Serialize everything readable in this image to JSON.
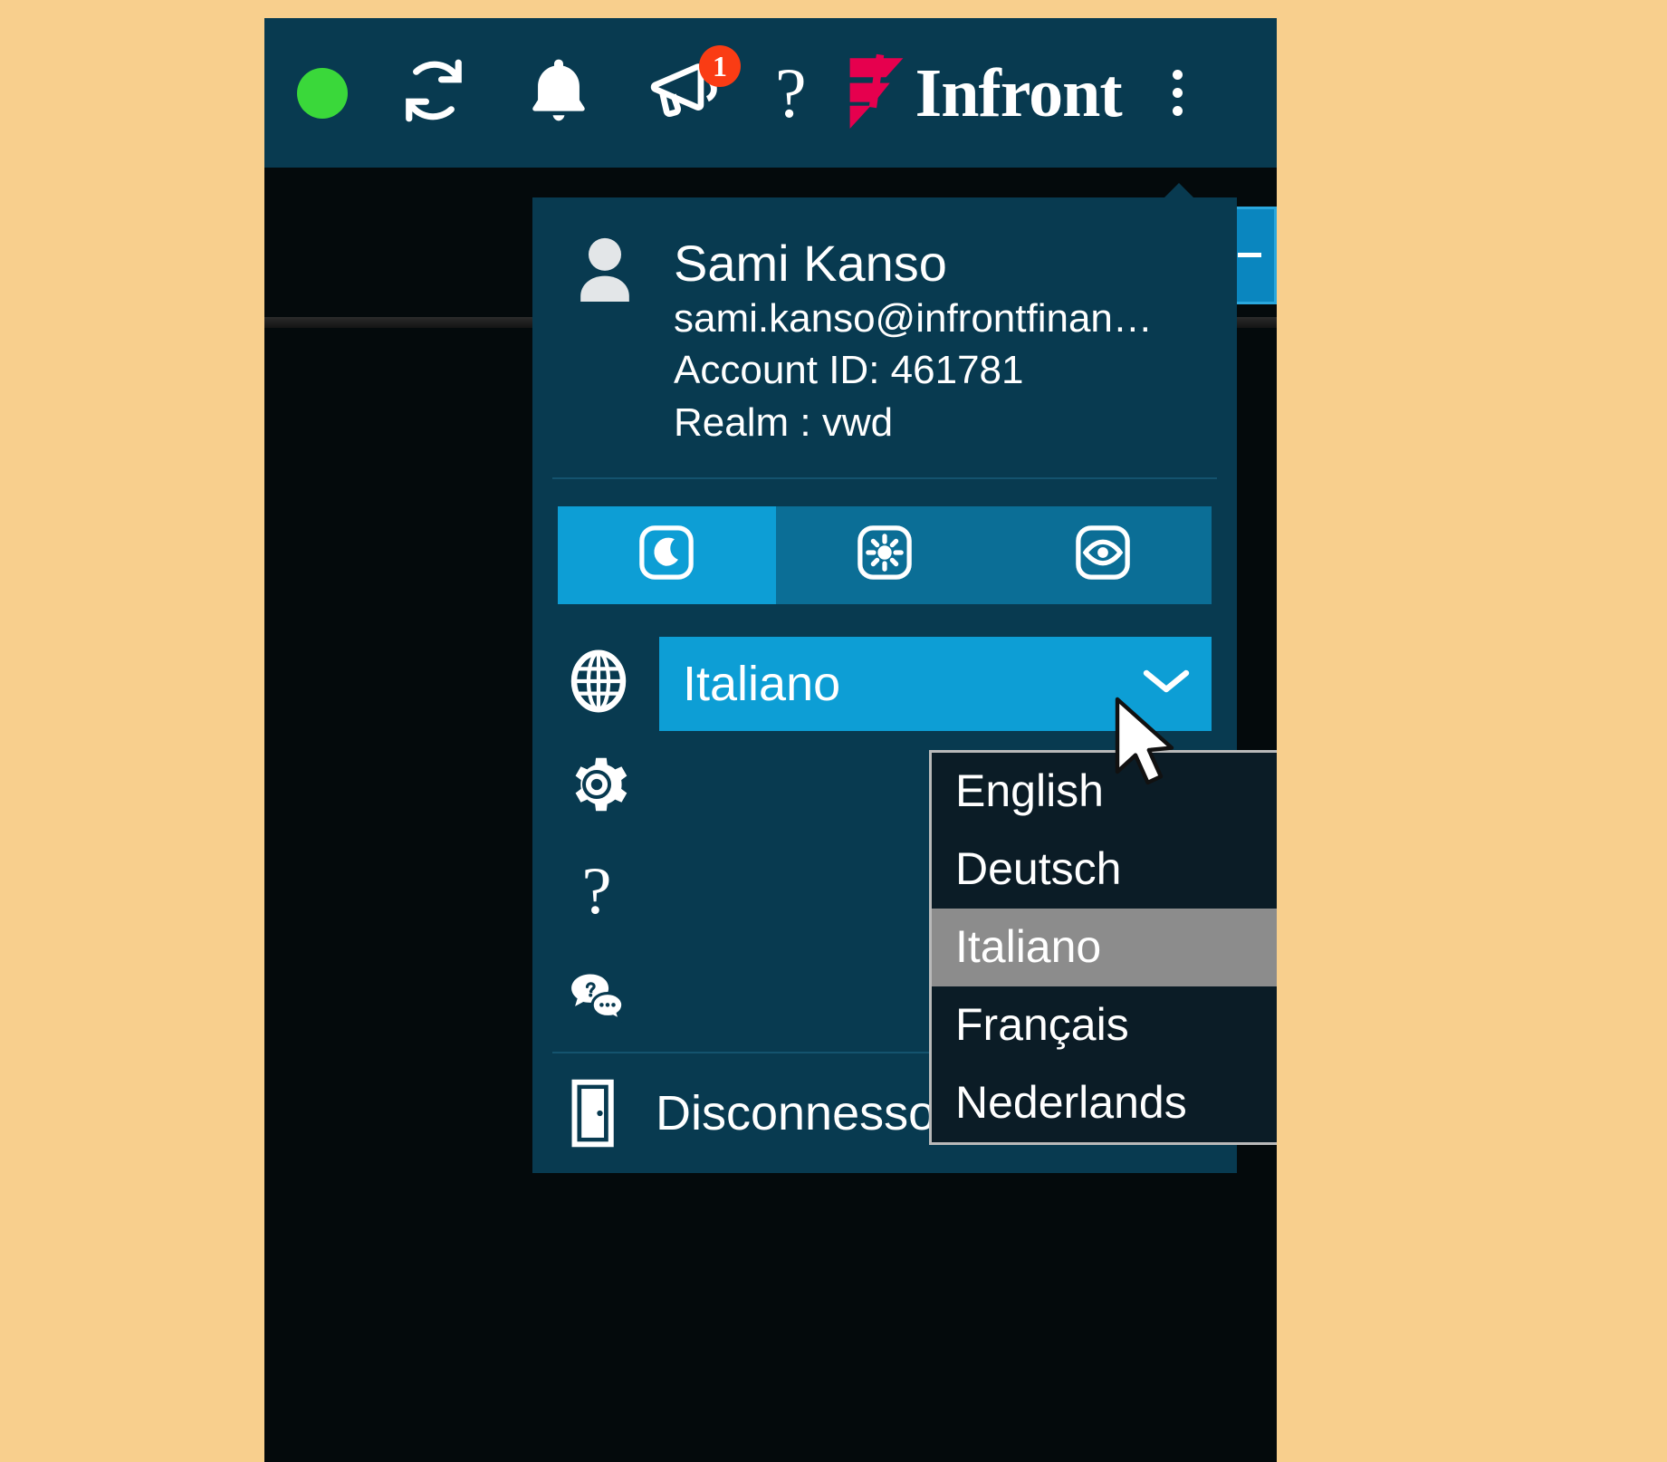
{
  "window": {
    "background_color": "#040a0c",
    "toolbar_color": "#083a50",
    "page_background": "#f8cf8d"
  },
  "toolbar": {
    "status_indicator": {
      "name": "connection status",
      "color": "#3ad83a",
      "icon": "green-dot-icon"
    },
    "refresh": {
      "label": "Refresh",
      "icon": "refresh-icon"
    },
    "alerts": {
      "label": "Alerts",
      "icon": "bell-icon"
    },
    "announcements": {
      "label": "Announcements",
      "icon": "megaphone-icon",
      "badge_count": "1",
      "badge_color": "#fa3c14"
    },
    "help": {
      "label": "Help",
      "icon": "question-mark-icon",
      "glyph": "?"
    },
    "brand": {
      "name": "Infront",
      "logo_color": "#e6004e",
      "icon": "infront-logo-icon"
    },
    "more": {
      "label": "More options",
      "icon": "kebab-menu-icon"
    }
  },
  "user_menu": {
    "avatar_icon": "user-avatar-icon",
    "name": "Sami Kanso",
    "email": "sami.kanso@infrontfinan…",
    "account_id": "Account ID: 461781",
    "realm": "Realm : vwd",
    "theme": {
      "active": "dark",
      "active_color": "#0d9ed5",
      "inactive_color": "#0b6e96",
      "options": [
        {
          "id": "dark",
          "label": "Dark theme",
          "icon": "moon-icon",
          "active": true
        },
        {
          "id": "light",
          "label": "Light theme",
          "icon": "sun-icon",
          "active": false
        },
        {
          "id": "contrast",
          "label": "High contrast",
          "icon": "eye-icon",
          "active": false
        }
      ]
    },
    "language": {
      "icon": "globe-icon",
      "selected": "Italiano",
      "chevron": "chevron-down-icon",
      "select_color": "#0d9ed5",
      "options": [
        {
          "label": "English",
          "selected": false
        },
        {
          "label": "Deutsch",
          "selected": false
        },
        {
          "label": "Italiano",
          "selected": true
        },
        {
          "label": "Français",
          "selected": false
        },
        {
          "label": "Nederlands",
          "selected": false
        }
      ],
      "highlight_color": "#8c8c8c"
    },
    "rows": [
      {
        "id": "settings",
        "icon": "gear-icon",
        "label": ""
      },
      {
        "id": "help",
        "icon": "question-mark-icon",
        "label": ""
      },
      {
        "id": "support-chat",
        "icon": "chat-help-icon",
        "label": ""
      }
    ],
    "logout": {
      "icon": "exit-door-icon",
      "label": "Disconnesso"
    }
  },
  "cursor": {
    "icon": "mouse-pointer-icon"
  }
}
